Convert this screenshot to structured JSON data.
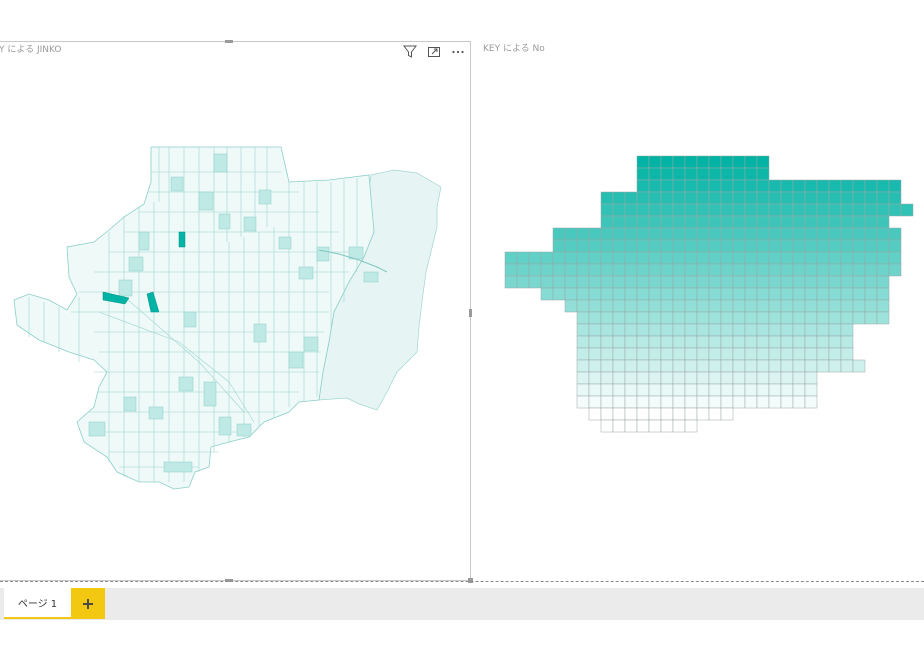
{
  "left_visual": {
    "title": "Y による JINKO",
    "icons": [
      "filter-icon",
      "focus-mode-icon",
      "more-options-icon"
    ]
  },
  "right_visual": {
    "title": "KEY による No"
  },
  "pages": {
    "tabs": [
      {
        "label": "ページ 1"
      }
    ],
    "add_icon": "plus-icon"
  },
  "colors": {
    "teal": "#00b3a4",
    "light_fill": "#e6f5f4",
    "mid_fill": "#bfe9e4",
    "tab_accent": "#f2c811"
  }
}
